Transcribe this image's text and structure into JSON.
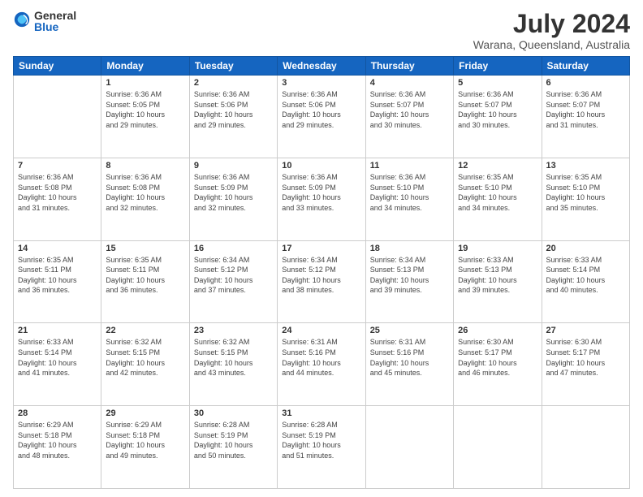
{
  "logo": {
    "general": "General",
    "blue": "Blue"
  },
  "title": "July 2024",
  "subtitle": "Warana, Queensland, Australia",
  "days_header": [
    "Sunday",
    "Monday",
    "Tuesday",
    "Wednesday",
    "Thursday",
    "Friday",
    "Saturday"
  ],
  "weeks": [
    [
      {
        "day": "",
        "info": ""
      },
      {
        "day": "1",
        "info": "Sunrise: 6:36 AM\nSunset: 5:05 PM\nDaylight: 10 hours\nand 29 minutes."
      },
      {
        "day": "2",
        "info": "Sunrise: 6:36 AM\nSunset: 5:06 PM\nDaylight: 10 hours\nand 29 minutes."
      },
      {
        "day": "3",
        "info": "Sunrise: 6:36 AM\nSunset: 5:06 PM\nDaylight: 10 hours\nand 29 minutes."
      },
      {
        "day": "4",
        "info": "Sunrise: 6:36 AM\nSunset: 5:07 PM\nDaylight: 10 hours\nand 30 minutes."
      },
      {
        "day": "5",
        "info": "Sunrise: 6:36 AM\nSunset: 5:07 PM\nDaylight: 10 hours\nand 30 minutes."
      },
      {
        "day": "6",
        "info": "Sunrise: 6:36 AM\nSunset: 5:07 PM\nDaylight: 10 hours\nand 31 minutes."
      }
    ],
    [
      {
        "day": "7",
        "info": "Sunrise: 6:36 AM\nSunset: 5:08 PM\nDaylight: 10 hours\nand 31 minutes."
      },
      {
        "day": "8",
        "info": "Sunrise: 6:36 AM\nSunset: 5:08 PM\nDaylight: 10 hours\nand 32 minutes."
      },
      {
        "day": "9",
        "info": "Sunrise: 6:36 AM\nSunset: 5:09 PM\nDaylight: 10 hours\nand 32 minutes."
      },
      {
        "day": "10",
        "info": "Sunrise: 6:36 AM\nSunset: 5:09 PM\nDaylight: 10 hours\nand 33 minutes."
      },
      {
        "day": "11",
        "info": "Sunrise: 6:36 AM\nSunset: 5:10 PM\nDaylight: 10 hours\nand 34 minutes."
      },
      {
        "day": "12",
        "info": "Sunrise: 6:35 AM\nSunset: 5:10 PM\nDaylight: 10 hours\nand 34 minutes."
      },
      {
        "day": "13",
        "info": "Sunrise: 6:35 AM\nSunset: 5:10 PM\nDaylight: 10 hours\nand 35 minutes."
      }
    ],
    [
      {
        "day": "14",
        "info": "Sunrise: 6:35 AM\nSunset: 5:11 PM\nDaylight: 10 hours\nand 36 minutes."
      },
      {
        "day": "15",
        "info": "Sunrise: 6:35 AM\nSunset: 5:11 PM\nDaylight: 10 hours\nand 36 minutes."
      },
      {
        "day": "16",
        "info": "Sunrise: 6:34 AM\nSunset: 5:12 PM\nDaylight: 10 hours\nand 37 minutes."
      },
      {
        "day": "17",
        "info": "Sunrise: 6:34 AM\nSunset: 5:12 PM\nDaylight: 10 hours\nand 38 minutes."
      },
      {
        "day": "18",
        "info": "Sunrise: 6:34 AM\nSunset: 5:13 PM\nDaylight: 10 hours\nand 39 minutes."
      },
      {
        "day": "19",
        "info": "Sunrise: 6:33 AM\nSunset: 5:13 PM\nDaylight: 10 hours\nand 39 minutes."
      },
      {
        "day": "20",
        "info": "Sunrise: 6:33 AM\nSunset: 5:14 PM\nDaylight: 10 hours\nand 40 minutes."
      }
    ],
    [
      {
        "day": "21",
        "info": "Sunrise: 6:33 AM\nSunset: 5:14 PM\nDaylight: 10 hours\nand 41 minutes."
      },
      {
        "day": "22",
        "info": "Sunrise: 6:32 AM\nSunset: 5:15 PM\nDaylight: 10 hours\nand 42 minutes."
      },
      {
        "day": "23",
        "info": "Sunrise: 6:32 AM\nSunset: 5:15 PM\nDaylight: 10 hours\nand 43 minutes."
      },
      {
        "day": "24",
        "info": "Sunrise: 6:31 AM\nSunset: 5:16 PM\nDaylight: 10 hours\nand 44 minutes."
      },
      {
        "day": "25",
        "info": "Sunrise: 6:31 AM\nSunset: 5:16 PM\nDaylight: 10 hours\nand 45 minutes."
      },
      {
        "day": "26",
        "info": "Sunrise: 6:30 AM\nSunset: 5:17 PM\nDaylight: 10 hours\nand 46 minutes."
      },
      {
        "day": "27",
        "info": "Sunrise: 6:30 AM\nSunset: 5:17 PM\nDaylight: 10 hours\nand 47 minutes."
      }
    ],
    [
      {
        "day": "28",
        "info": "Sunrise: 6:29 AM\nSunset: 5:18 PM\nDaylight: 10 hours\nand 48 minutes."
      },
      {
        "day": "29",
        "info": "Sunrise: 6:29 AM\nSunset: 5:18 PM\nDaylight: 10 hours\nand 49 minutes."
      },
      {
        "day": "30",
        "info": "Sunrise: 6:28 AM\nSunset: 5:19 PM\nDaylight: 10 hours\nand 50 minutes."
      },
      {
        "day": "31",
        "info": "Sunrise: 6:28 AM\nSunset: 5:19 PM\nDaylight: 10 hours\nand 51 minutes."
      },
      {
        "day": "",
        "info": ""
      },
      {
        "day": "",
        "info": ""
      },
      {
        "day": "",
        "info": ""
      }
    ]
  ]
}
